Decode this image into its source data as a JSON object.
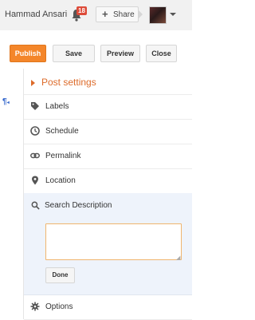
{
  "account": {
    "username": "Hammad Ansari",
    "notification_count": "18",
    "share_label": "Share"
  },
  "toolbar": {
    "publish_label": "Publish",
    "save_label": "Save",
    "preview_label": "Preview",
    "close_label": "Close"
  },
  "editor": {
    "gutter_symbol": "¶"
  },
  "post_settings": {
    "title": "Post settings",
    "items": [
      {
        "label": "Labels",
        "icon": "tag-icon"
      },
      {
        "label": "Schedule",
        "icon": "clock-icon"
      },
      {
        "label": "Permalink",
        "icon": "link-icon"
      },
      {
        "label": "Location",
        "icon": "pin-icon"
      }
    ],
    "search_description": {
      "label": "Search Description",
      "icon": "search-icon",
      "value": "",
      "done_label": "Done"
    },
    "options": {
      "label": "Options",
      "icon": "gear-icon"
    }
  },
  "colors": {
    "accent": "#dd6b2a",
    "publish_bg": "#f4862a",
    "badge": "#dd4b39",
    "search_section_bg": "#eef3fb",
    "input_border": "#f0b56e"
  }
}
